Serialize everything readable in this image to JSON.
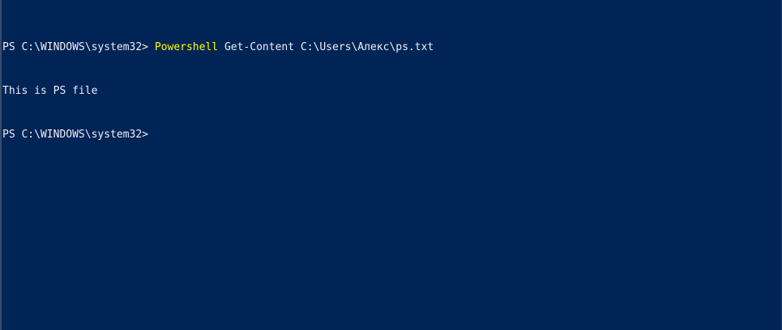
{
  "colors": {
    "background": "#012456",
    "text": "#eeedf0",
    "command_keyword": "#ffff00"
  },
  "console": {
    "lines": [
      {
        "prompt": "PS C:\\WINDOWS\\system32> ",
        "command": "Powershell",
        "args": " Get-Content C:\\Users\\Алекс\\ps.txt"
      },
      {
        "output": "This is PS file"
      },
      {
        "prompt": "PS C:\\WINDOWS\\system32> ",
        "command": "",
        "args": ""
      }
    ]
  }
}
